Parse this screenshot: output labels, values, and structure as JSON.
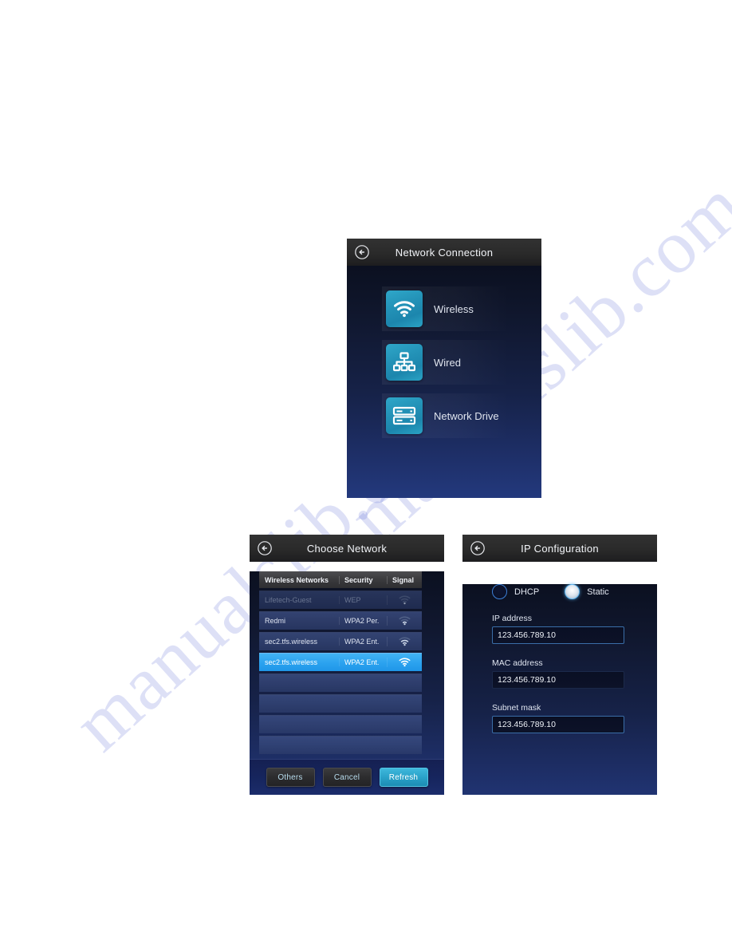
{
  "watermark": {
    "text": "manualslib.com"
  },
  "panel_connection": {
    "title": "Network Connection",
    "back_icon": "back-arrow-icon",
    "options": [
      {
        "label": "Wireless",
        "icon": "wifi-icon"
      },
      {
        "label": "Wired",
        "icon": "ethernet-icon"
      },
      {
        "label": "Network Drive",
        "icon": "server-stack-icon"
      }
    ]
  },
  "panel_choose": {
    "title": "Choose Network",
    "back_icon": "back-arrow-icon",
    "columns": [
      "Wireless Networks",
      "Security",
      "Signal"
    ],
    "rows": [
      {
        "name": "Lifetech-Guest",
        "security": "WEP",
        "signal": 1,
        "state": "dim"
      },
      {
        "name": "Redmi",
        "security": "WPA2 Per.",
        "signal": 2,
        "state": "normal"
      },
      {
        "name": "sec2.tfs.wireless",
        "security": "WPA2 Ent.",
        "signal": 3,
        "state": "normal"
      },
      {
        "name": "sec2.tfs.wireless",
        "security": "WPA2 Ent.",
        "signal": 4,
        "state": "selected"
      },
      {
        "name": "",
        "security": "",
        "signal": 0,
        "state": "empty"
      },
      {
        "name": "",
        "security": "",
        "signal": 0,
        "state": "empty"
      },
      {
        "name": "",
        "security": "",
        "signal": 0,
        "state": "empty"
      },
      {
        "name": "",
        "security": "",
        "signal": 0,
        "state": "empty"
      }
    ],
    "buttons": [
      {
        "label": "Others",
        "style": "dark"
      },
      {
        "label": "Cancel",
        "style": "dark"
      },
      {
        "label": "Refresh",
        "style": "primary"
      }
    ]
  },
  "panel_ip": {
    "title": "IP Configuration",
    "back_icon": "back-arrow-icon",
    "modes": [
      {
        "label": "DHCP",
        "selected": false
      },
      {
        "label": "Static",
        "selected": true
      }
    ],
    "fields": [
      {
        "label": "IP address",
        "value": "123.456.789.10",
        "focused": true
      },
      {
        "label": "MAC address",
        "value": "123.456.789.10",
        "focused": false
      },
      {
        "label": "Subnet mask",
        "value": "123.456.789.10",
        "focused": true
      }
    ]
  },
  "colors": {
    "accent": "#2aa2c9",
    "selected_row": "#2ba2ef",
    "panel_dark": "#0b1020",
    "titlebar": "#2a2a2a"
  }
}
